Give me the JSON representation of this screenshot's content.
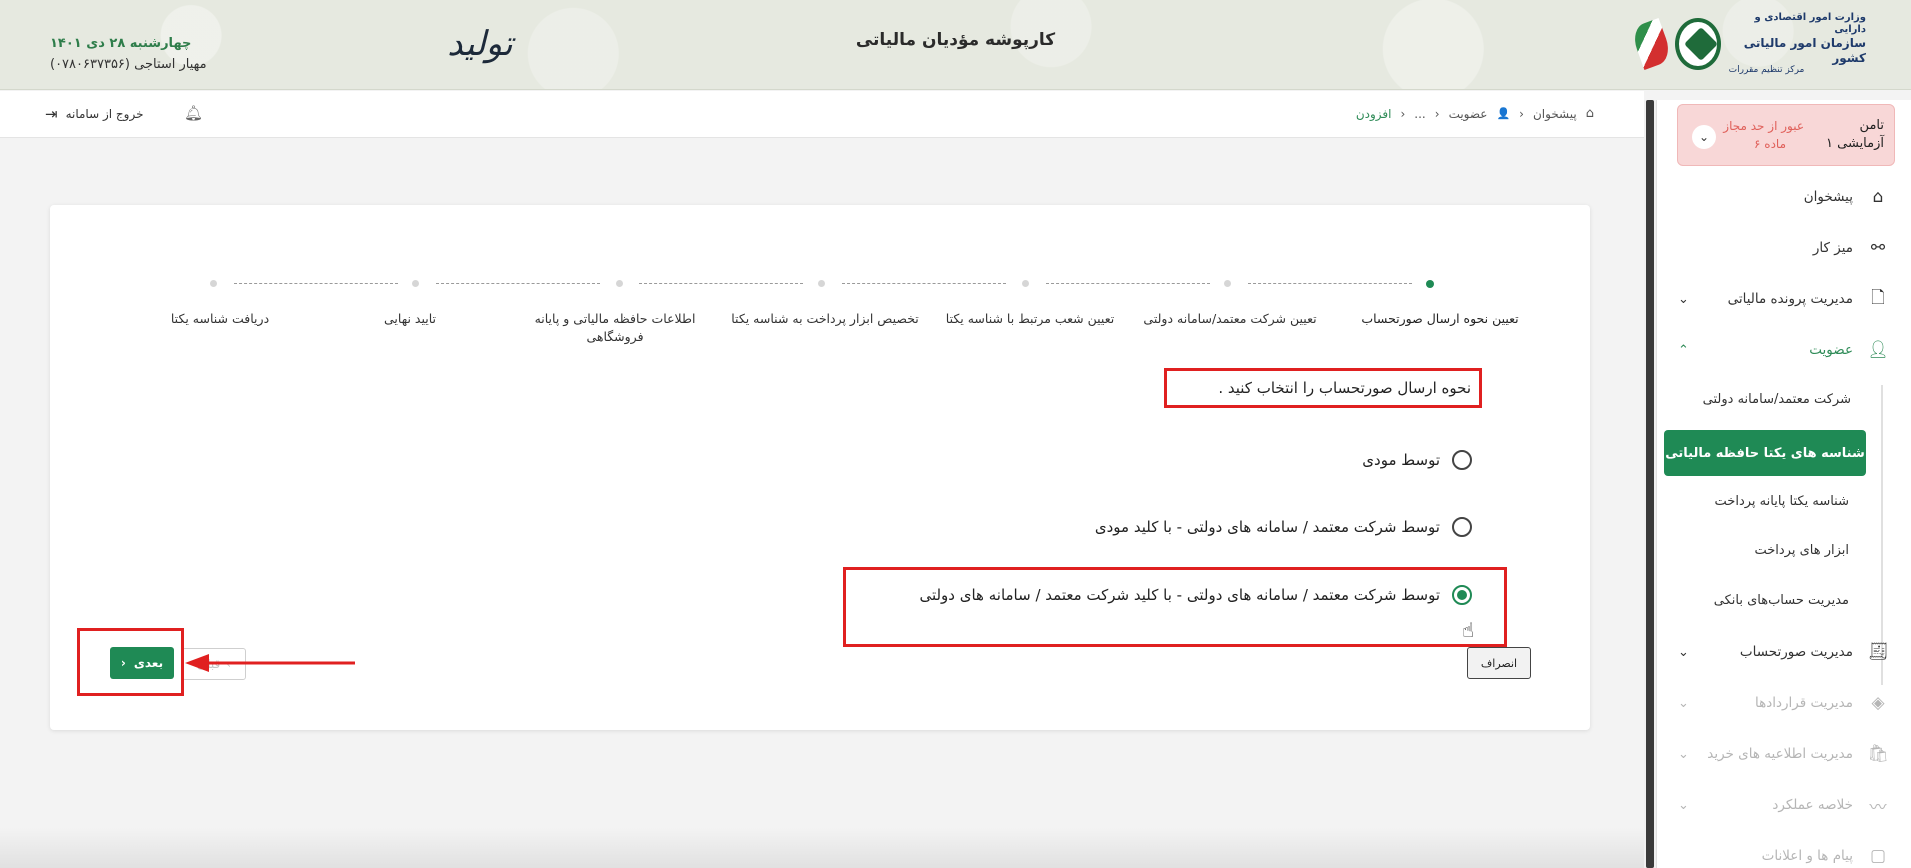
{
  "header": {
    "title": "کارپوشه مؤدیان مالیاتی",
    "date": "چهارشنبه ۲۸ دی ۱۴۰۱",
    "user": "مهیار استاجی (۰۷۸۰۶۳۷۳۵۶)",
    "calligraphy": "تولید",
    "logo": {
      "line1": "وزارت امور اقتصادی و دارایی",
      "line2": "سازمان امور مالیاتی کشور",
      "line3": "مرکز تنظیم مقررات"
    }
  },
  "topbar": {
    "breadcrumb": [
      "پیشخوان",
      "عضویت",
      "...",
      "افزودن"
    ],
    "logout_label": "خروج از سامانه"
  },
  "sidebar": {
    "taxpayer_name_line1": "تامن",
    "taxpayer_name_line2": "آزمایشی ۱",
    "warning_line1": "عبور از حد مجاز",
    "warning_line2": "ماده ۶",
    "items": [
      {
        "label": "پیشخوان",
        "icon": "home-icon"
      },
      {
        "label": "میز کار",
        "icon": "shapes-icon"
      },
      {
        "label": "مدیریت پرونده مالیاتی",
        "icon": "file-icon"
      },
      {
        "label": "عضویت",
        "icon": "user-icon"
      },
      {
        "label": "مدیریت صورتحساب",
        "icon": "invoice-icon"
      },
      {
        "label": "مدیریت قراردادها",
        "icon": "handshake-icon"
      },
      {
        "label": "مدیریت اطلاعیه های خرید",
        "icon": "bag-icon"
      },
      {
        "label": "خلاصه عملکرد",
        "icon": "chart-icon"
      },
      {
        "label": "پیام ها و اعلانات",
        "icon": "message-icon"
      }
    ],
    "sub_items": [
      "شرکت معتمد/سامانه دولتی",
      "شناسه های یکتا حافظه مالیاتی",
      "شناسه یکتا پایانه پرداخت",
      "ابزار های پرداخت",
      "مدیریت حساب‌های بانکی"
    ]
  },
  "stepper": {
    "steps": [
      "تعیین نحوه ارسال صورتحساب",
      "تعیین شرکت معتمد/سامانه دولتی",
      "تعیین شعب مرتبط با شناسه یکتا",
      "تخصیص ابزار پرداخت به شناسه یکتا",
      "اطلاعات حافظه مالیاتی و پایانه فروشگاهی",
      "تایید نهایی",
      "دریافت شناسه یکتا"
    ],
    "active_index": 0
  },
  "form": {
    "question": "نحوه ارسال صورتحساب را انتخاب کنید .",
    "options": [
      "توسط مودی",
      "توسط شرکت معتمد / سامانه های دولتی - با کلید مودی",
      "توسط شرکت معتمد / سامانه های دولتی - با کلید شرکت معتمد / سامانه های دولتی"
    ],
    "selected_index": 2,
    "cancel_label": "انصراف",
    "prev_label": "قبلی",
    "next_label": "بعدی"
  },
  "colors": {
    "brand_green": "#1f8a55",
    "annotation_red": "#e02020",
    "warning_bg": "#f8d7d7"
  }
}
